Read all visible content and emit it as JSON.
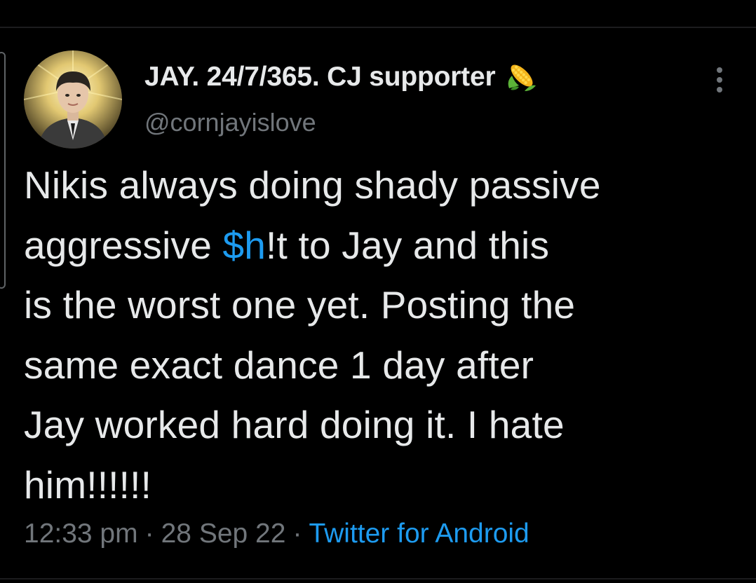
{
  "tweet": {
    "author": {
      "display_name": "JAY. 24/7/365. CJ supporter",
      "name_emoji": "corn-icon",
      "handle": "@cornjayislove"
    },
    "text_lines": [
      {
        "before": "Nikis always doing shady passive",
        "cashtag": "",
        "after": ""
      },
      {
        "before": "aggressive ",
        "cashtag": "$h",
        "after": "!t to Jay and this"
      },
      {
        "before": "is the worst one yet. Posting the",
        "cashtag": "",
        "after": ""
      },
      {
        "before": "same exact dance 1 day after",
        "cashtag": "",
        "after": ""
      },
      {
        "before": "Jay worked hard doing it. I hate",
        "cashtag": "",
        "after": ""
      },
      {
        "before": "him!!!!!!",
        "cashtag": "",
        "after": ""
      }
    ],
    "meta": {
      "time": "12:33 pm",
      "separator": "·",
      "date": "28 Sep 22",
      "source": "Twitter for Android"
    }
  },
  "colors": {
    "background": "#000000",
    "primary_text": "#e7e9ea",
    "secondary_text": "#71767b",
    "link": "#1d9bf0"
  }
}
